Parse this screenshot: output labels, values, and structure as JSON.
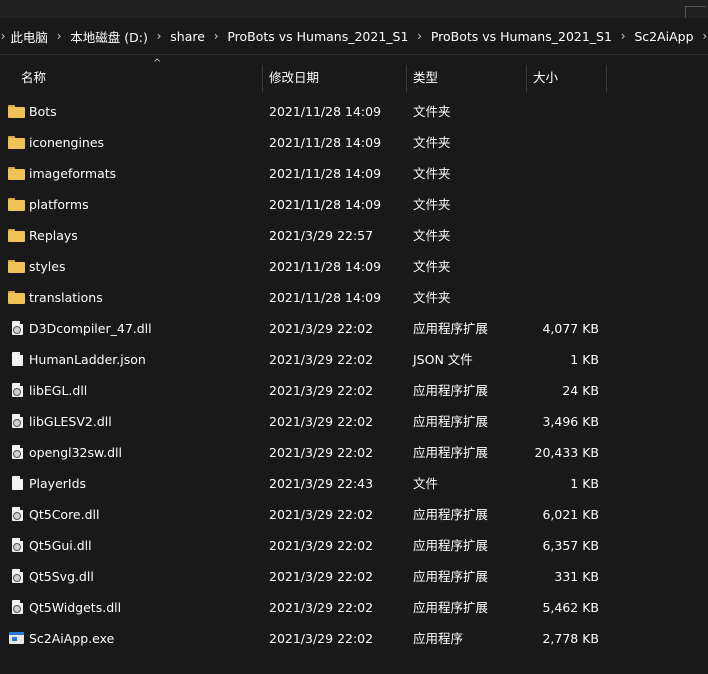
{
  "breadcrumb": [
    "此电脑",
    "本地磁盘 (D:)",
    "share",
    "ProBots vs Humans_2021_S1",
    "ProBots vs Humans_2021_S1",
    "Sc2AiApp"
  ],
  "columns": {
    "name": "名称",
    "date": "修改日期",
    "type": "类型",
    "size": "大小"
  },
  "sort_indicator": "^",
  "files": [
    {
      "icon": "folder-icon",
      "name": "Bots",
      "date": "2021/11/28 14:09",
      "type": "文件夹",
      "size": ""
    },
    {
      "icon": "folder-icon",
      "name": "iconengines",
      "date": "2021/11/28 14:09",
      "type": "文件夹",
      "size": ""
    },
    {
      "icon": "folder-icon",
      "name": "imageformats",
      "date": "2021/11/28 14:09",
      "type": "文件夹",
      "size": ""
    },
    {
      "icon": "folder-icon",
      "name": "platforms",
      "date": "2021/11/28 14:09",
      "type": "文件夹",
      "size": ""
    },
    {
      "icon": "folder-icon",
      "name": "Replays",
      "date": "2021/3/29 22:57",
      "type": "文件夹",
      "size": ""
    },
    {
      "icon": "folder-icon",
      "name": "styles",
      "date": "2021/11/28 14:09",
      "type": "文件夹",
      "size": ""
    },
    {
      "icon": "folder-icon",
      "name": "translations",
      "date": "2021/11/28 14:09",
      "type": "文件夹",
      "size": ""
    },
    {
      "icon": "dll-file-icon",
      "name": "D3Dcompiler_47.dll",
      "date": "2021/3/29 22:02",
      "type": "应用程序扩展",
      "size": "4,077 KB"
    },
    {
      "icon": "file-icon",
      "name": "HumanLadder.json",
      "date": "2021/3/29 22:02",
      "type": "JSON 文件",
      "size": "1 KB"
    },
    {
      "icon": "dll-file-icon",
      "name": "libEGL.dll",
      "date": "2021/3/29 22:02",
      "type": "应用程序扩展",
      "size": "24 KB"
    },
    {
      "icon": "dll-file-icon",
      "name": "libGLESV2.dll",
      "date": "2021/3/29 22:02",
      "type": "应用程序扩展",
      "size": "3,496 KB"
    },
    {
      "icon": "dll-file-icon",
      "name": "opengl32sw.dll",
      "date": "2021/3/29 22:02",
      "type": "应用程序扩展",
      "size": "20,433 KB"
    },
    {
      "icon": "file-icon",
      "name": "PlayerIds",
      "date": "2021/3/29 22:43",
      "type": "文件",
      "size": "1 KB"
    },
    {
      "icon": "dll-file-icon",
      "name": "Qt5Core.dll",
      "date": "2021/3/29 22:02",
      "type": "应用程序扩展",
      "size": "6,021 KB"
    },
    {
      "icon": "dll-file-icon",
      "name": "Qt5Gui.dll",
      "date": "2021/3/29 22:02",
      "type": "应用程序扩展",
      "size": "6,357 KB"
    },
    {
      "icon": "dll-file-icon",
      "name": "Qt5Svg.dll",
      "date": "2021/3/29 22:02",
      "type": "应用程序扩展",
      "size": "331 KB"
    },
    {
      "icon": "dll-file-icon",
      "name": "Qt5Widgets.dll",
      "date": "2021/3/29 22:02",
      "type": "应用程序扩展",
      "size": "5,462 KB"
    },
    {
      "icon": "exe-file-icon",
      "name": "Sc2AiApp.exe",
      "date": "2021/3/29 22:02",
      "type": "应用程序",
      "size": "2,778 KB"
    }
  ]
}
